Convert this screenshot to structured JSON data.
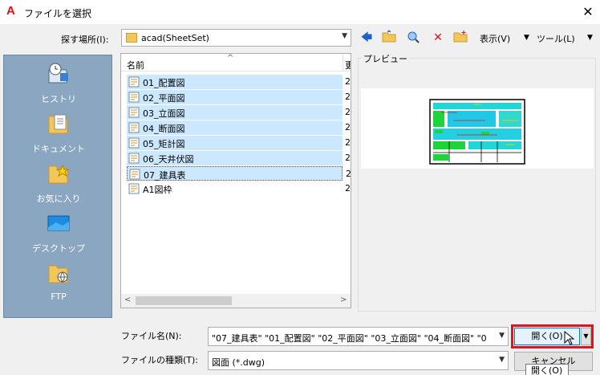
{
  "title": "ファイルを選択",
  "look_in": {
    "label": "探す場所(I):",
    "value": "acad(SheetSet)"
  },
  "toolbar": {
    "view_label": "表示(V)",
    "tools_label": "ツール(L)"
  },
  "places": [
    "ヒストリ",
    "ドキュメント",
    "お気に入り",
    "デスクトップ",
    "FTP"
  ],
  "file_list": {
    "header_name": "名前",
    "header_date": "更",
    "items": [
      {
        "name": "01_配置図",
        "date": "2"
      },
      {
        "name": "02_平面図",
        "date": "2"
      },
      {
        "name": "03_立面図",
        "date": "2"
      },
      {
        "name": "04_断面図",
        "date": "2"
      },
      {
        "name": "05_矩計図",
        "date": "2"
      },
      {
        "name": "06_天井伏図",
        "date": "2"
      },
      {
        "name": "07_建具表",
        "date": "2"
      },
      {
        "name": "A1図枠",
        "date": "2"
      }
    ]
  },
  "preview": {
    "label": "プレビュー"
  },
  "file_name": {
    "label": "ファイル名(N):",
    "value": "\"07_建具表\" \"01_配置図\" \"02_平面図\" \"03_立面図\" \"04_断面図\" \"0"
  },
  "file_type": {
    "label": "ファイルの種類(T):",
    "value": "図面 (*.dwg)"
  },
  "buttons": {
    "open": "開く(O)",
    "cancel": "キャンセル"
  },
  "tooltip": "開く(O)",
  "colors": {
    "selection": "#cce8ff",
    "highlight": "#e0141e",
    "places_bg": "#8aa6c1"
  }
}
